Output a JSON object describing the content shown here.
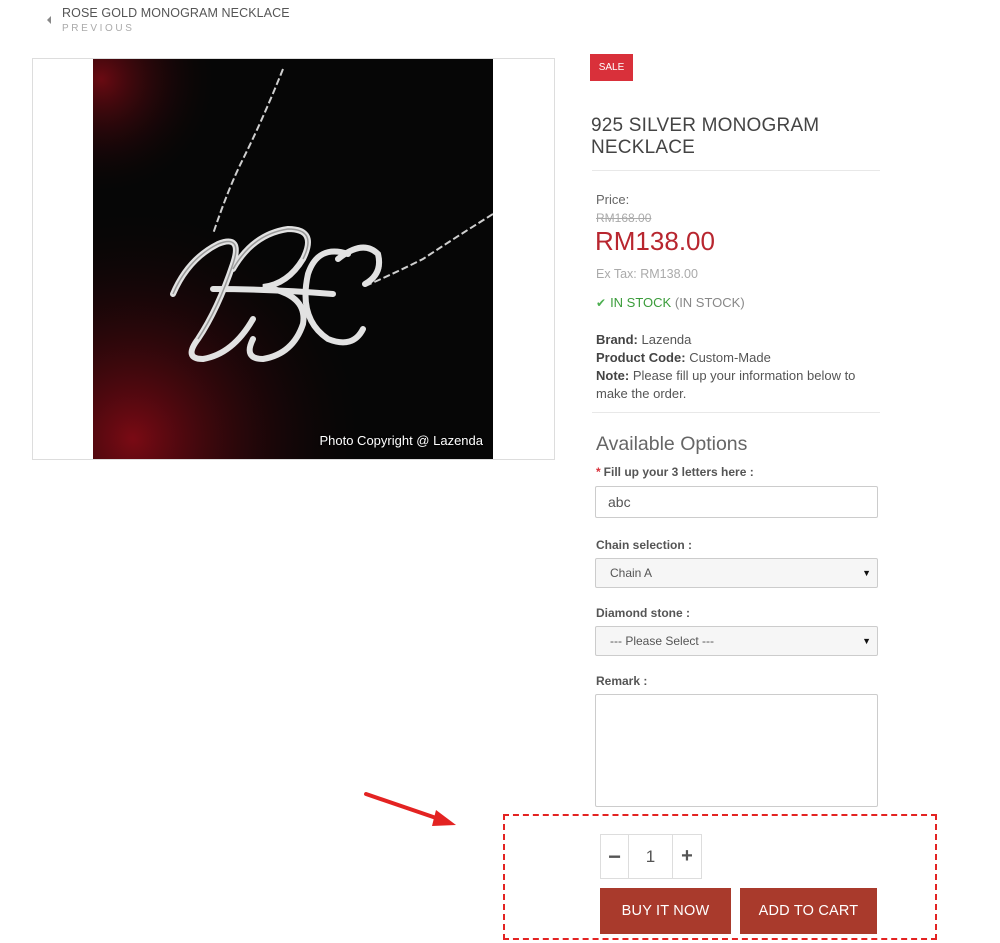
{
  "prev_nav": {
    "title": "ROSE GOLD MONOGRAM NECKLACE",
    "subtitle": "PREVIOUS"
  },
  "product_image": {
    "caption": "Photo Copyright @ Lazenda"
  },
  "badge": "SALE",
  "product": {
    "title": "925 SILVER MONOGRAM NECKLACE",
    "price_label": "Price:",
    "old_price": "RM168.00",
    "new_price": "RM138.00",
    "ex_tax": "Ex Tax: RM138.00",
    "stock_status": "IN STOCK",
    "stock_note": "(IN STOCK)",
    "brand_label": "Brand:",
    "brand_value": "Lazenda",
    "code_label": "Product Code:",
    "code_value": "Custom-Made",
    "note_label": "Note:",
    "note_value": "Please fill up your information below to make the order."
  },
  "options": {
    "title": "Available Options",
    "required_mark": "*",
    "letters_label": "Fill up your 3 letters here :",
    "letters_value": "abc",
    "chain_label": "Chain selection :",
    "chain_value": "Chain A",
    "diamond_label": "Diamond stone :",
    "diamond_value": "--- Please Select ---",
    "remark_label": "Remark :",
    "remark_value": ""
  },
  "cart": {
    "minus": "−",
    "quantity": "1",
    "plus": "+",
    "buy_now": "BUY IT NOW",
    "add_to_cart": "ADD TO CART"
  },
  "colors": {
    "sale": "#d9303a",
    "price": "#b8262f",
    "in_stock": "#3a9c3a",
    "button": "#a93a2c",
    "annotation": "#e32322"
  }
}
